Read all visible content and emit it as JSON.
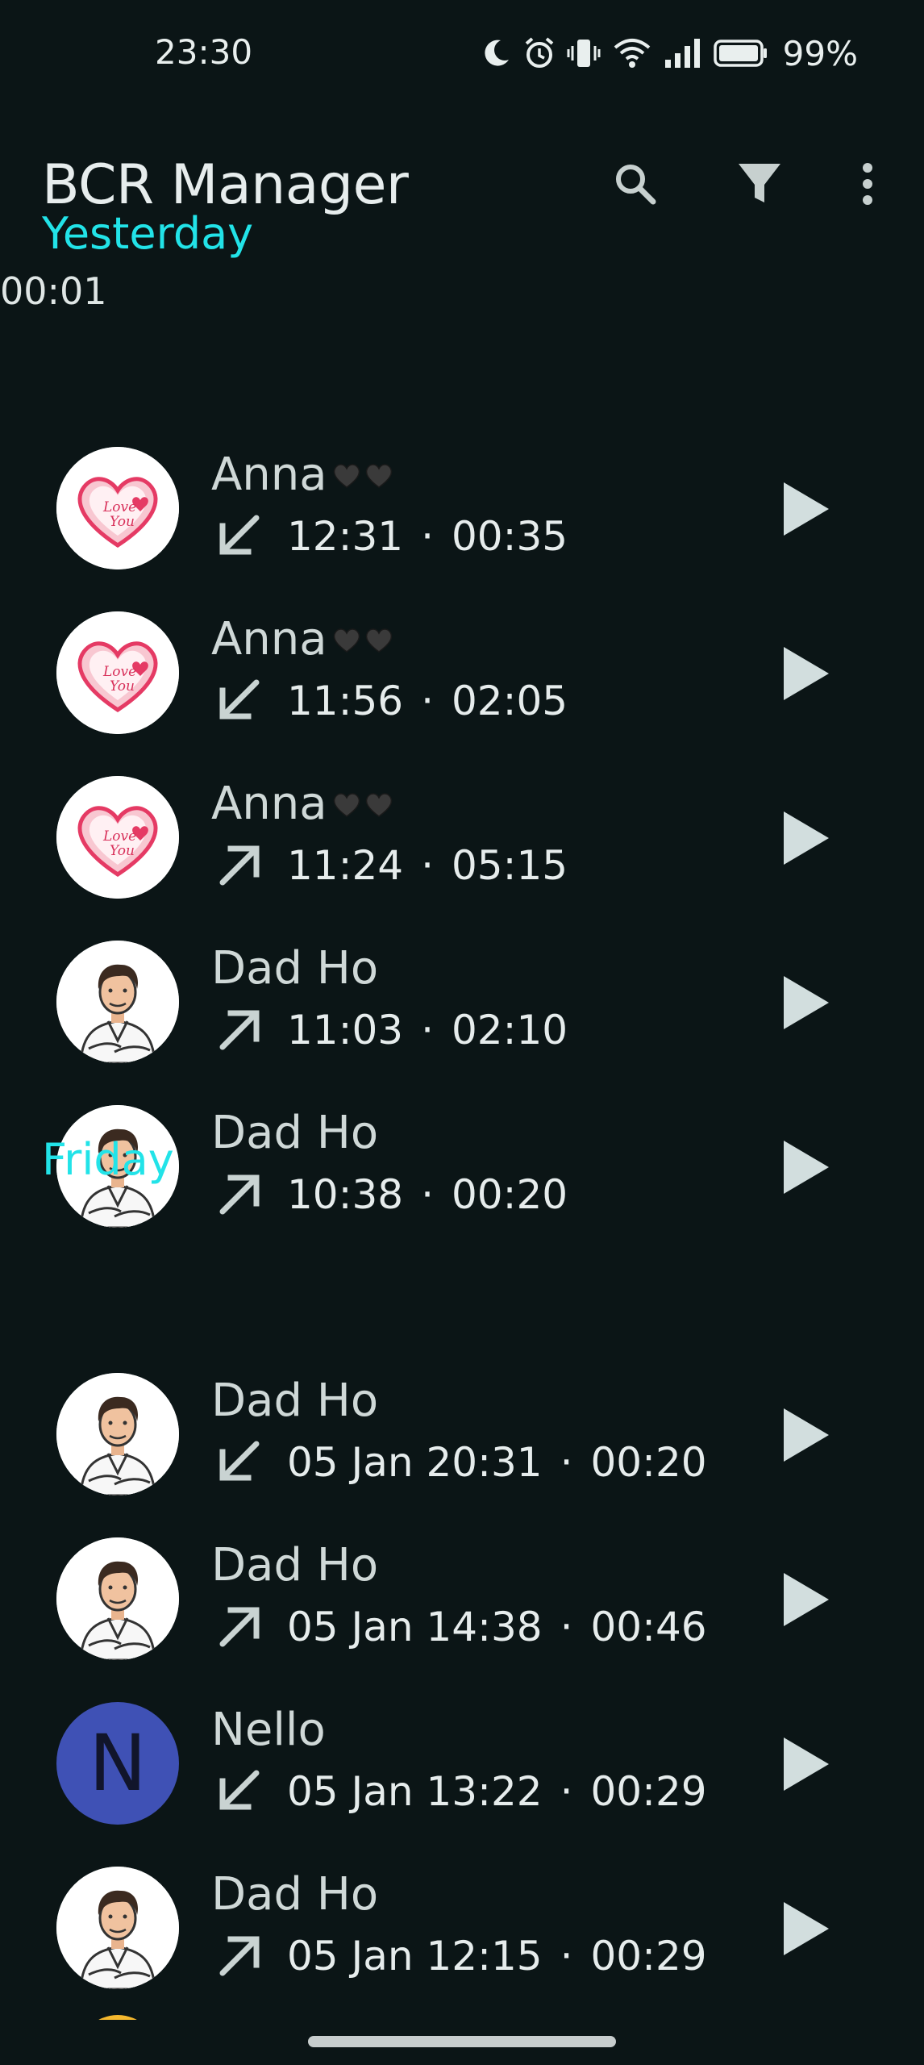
{
  "status_bar": {
    "time": "23:30",
    "battery": "99%",
    "icons": [
      "moon-icon",
      "alarm-icon",
      "vibrate-icon",
      "wifi-icon",
      "signal-icon",
      "battery-icon"
    ]
  },
  "app_bar": {
    "title": "BCR Manager",
    "actions": [
      "search-icon",
      "filter-icon",
      "more-vert-icon"
    ]
  },
  "progress_text": "00:01",
  "sections": [
    {
      "header": "Yesterday",
      "items": [
        {
          "name": "Anna",
          "avatar": "love-heart",
          "direction": "incoming",
          "time": "12:31",
          "duration": "00:35"
        },
        {
          "name": "Anna",
          "avatar": "love-heart",
          "direction": "incoming",
          "time": "11:56",
          "duration": "02:05"
        },
        {
          "name": "Anna",
          "avatar": "love-heart",
          "direction": "outgoing",
          "time": "11:24",
          "duration": "05:15"
        },
        {
          "name": "Dad Ho",
          "avatar": "man-cartoon",
          "direction": "outgoing",
          "time": "11:03",
          "duration": "02:10"
        },
        {
          "name": "Dad Ho",
          "avatar": "man-cartoon",
          "direction": "outgoing",
          "time": "10:38",
          "duration": "00:20"
        }
      ]
    },
    {
      "header": "Friday",
      "items": [
        {
          "name": "Dad Ho",
          "avatar": "man-cartoon",
          "direction": "incoming",
          "time": "05 Jan 20:31",
          "duration": "00:20"
        },
        {
          "name": "Dad Ho",
          "avatar": "man-cartoon",
          "direction": "outgoing",
          "time": "05 Jan 14:38",
          "duration": "00:46"
        },
        {
          "name": "Nello",
          "avatar": "letter",
          "avatar_letter": "N",
          "direction": "incoming",
          "time": "05 Jan 13:22",
          "duration": "00:29"
        },
        {
          "name": "Dad Ho",
          "avatar": "man-cartoon",
          "direction": "outgoing",
          "time": "05 Jan 12:15",
          "duration": "00:29"
        }
      ]
    }
  ],
  "meta_separator": "·",
  "heart_suffix_icon": "black-heart-icon",
  "colors": {
    "background": "#0b1516",
    "section_header": "#22e3e8",
    "text_primary": "#e6ecec",
    "text_secondary": "#cfd8d7",
    "play_icon": "#d2dede",
    "letter_avatar": "#3f51b5"
  }
}
